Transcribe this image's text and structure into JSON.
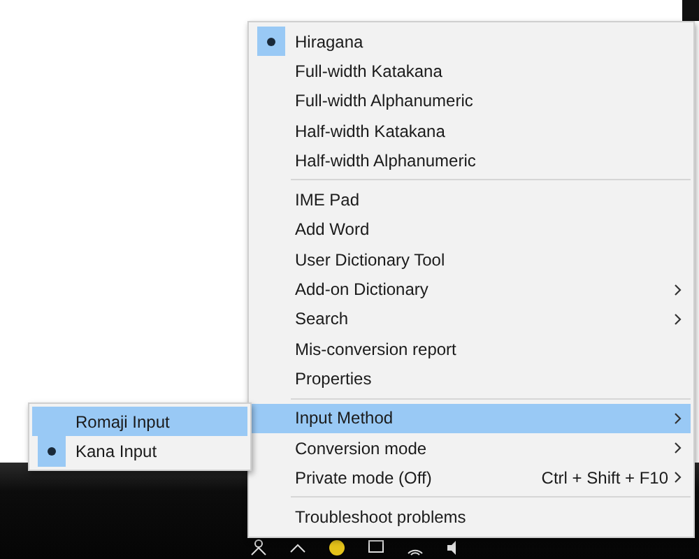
{
  "menu": {
    "sections": [
      {
        "items": [
          {
            "label": "Hiragana",
            "selected": true,
            "highlighted": false,
            "submenu": false
          },
          {
            "label": "Full-width Katakana",
            "selected": false,
            "highlighted": false,
            "submenu": false
          },
          {
            "label": "Full-width Alphanumeric",
            "selected": false,
            "highlighted": false,
            "submenu": false
          },
          {
            "label": "Half-width Katakana",
            "selected": false,
            "highlighted": false,
            "submenu": false
          },
          {
            "label": "Half-width Alphanumeric",
            "selected": false,
            "highlighted": false,
            "submenu": false
          }
        ]
      },
      {
        "items": [
          {
            "label": "IME Pad",
            "selected": false,
            "highlighted": false,
            "submenu": false
          },
          {
            "label": "Add Word",
            "selected": false,
            "highlighted": false,
            "submenu": false
          },
          {
            "label": "User Dictionary Tool",
            "selected": false,
            "highlighted": false,
            "submenu": false
          },
          {
            "label": "Add-on Dictionary",
            "selected": false,
            "highlighted": false,
            "submenu": true
          },
          {
            "label": "Search",
            "selected": false,
            "highlighted": false,
            "submenu": true
          },
          {
            "label": "Mis-conversion report",
            "selected": false,
            "highlighted": false,
            "submenu": false
          },
          {
            "label": "Properties",
            "selected": false,
            "highlighted": false,
            "submenu": false
          }
        ]
      },
      {
        "items": [
          {
            "label": "Input Method",
            "selected": false,
            "highlighted": true,
            "submenu": true
          },
          {
            "label": "Conversion mode",
            "selected": false,
            "highlighted": false,
            "submenu": true
          },
          {
            "label": "Private mode (Off)",
            "shortcut": "Ctrl + Shift + F10",
            "selected": false,
            "highlighted": false,
            "submenu": true
          }
        ]
      },
      {
        "items": [
          {
            "label": "Troubleshoot problems",
            "selected": false,
            "highlighted": false,
            "submenu": false
          }
        ]
      }
    ]
  },
  "submenu": {
    "items": [
      {
        "label": "Romaji Input",
        "selected": false,
        "highlighted": true
      },
      {
        "label": "Kana Input",
        "selected": true,
        "highlighted": false
      }
    ]
  }
}
